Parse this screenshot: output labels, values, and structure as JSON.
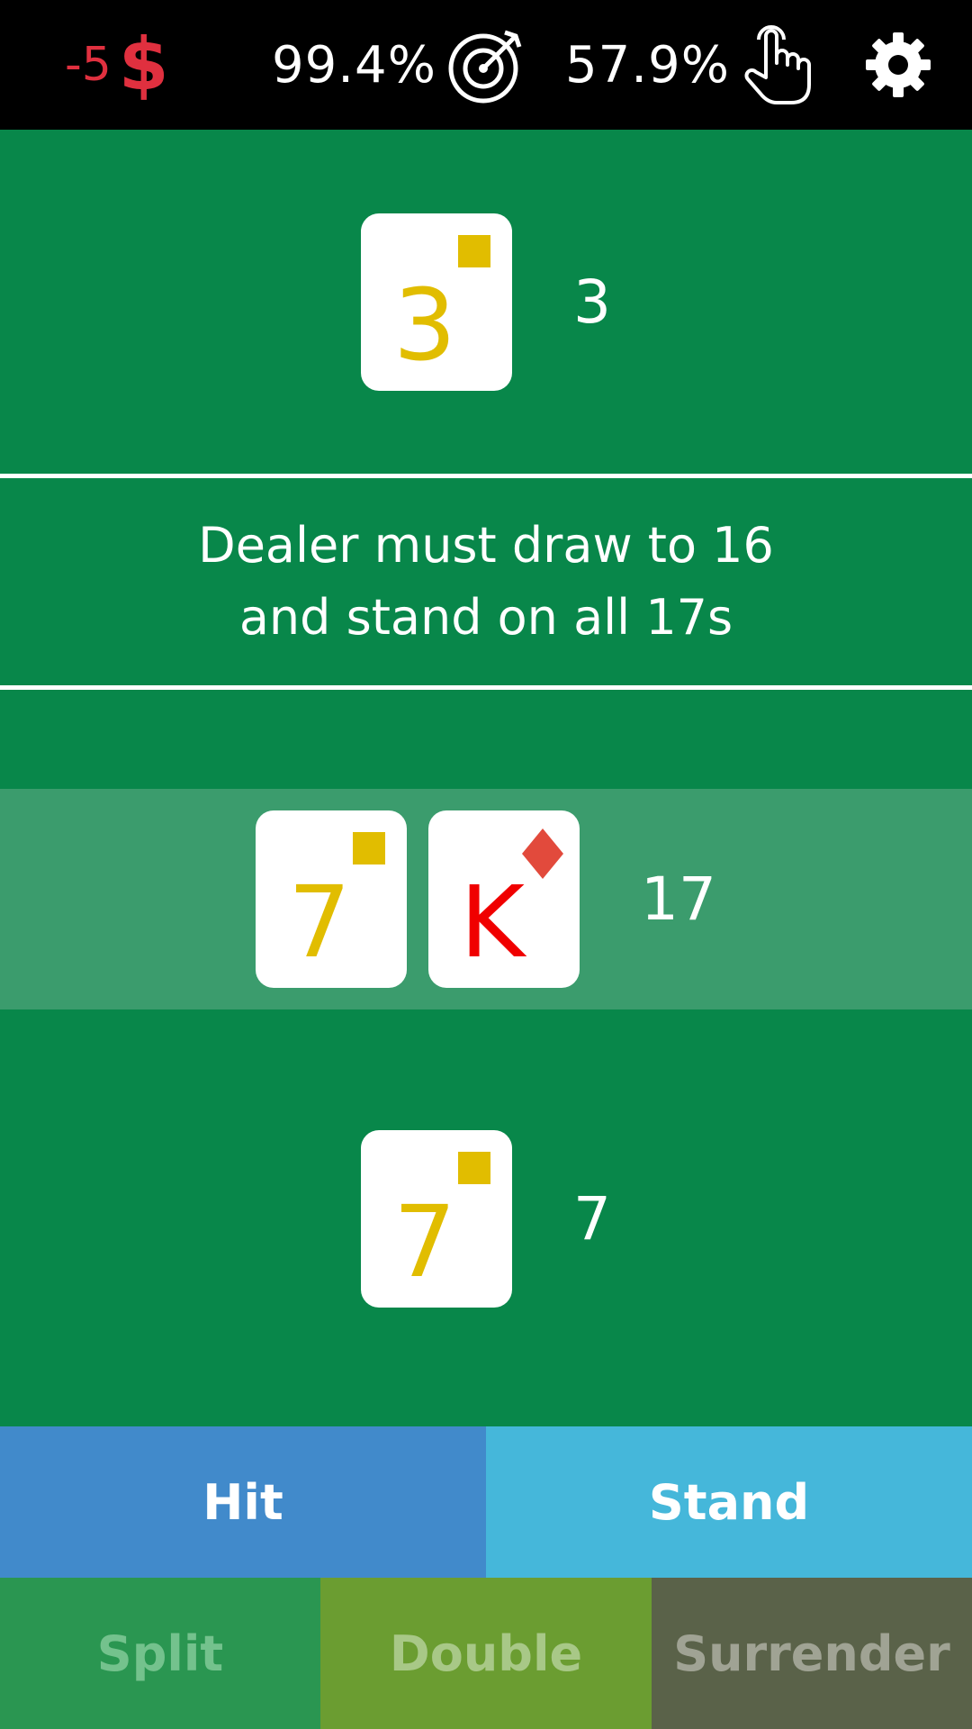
{
  "status_bar": {
    "balance": "-5",
    "currency_symbol": "$",
    "accuracy": "99.4%",
    "accuracy_icon": "target-icon",
    "win_rate": "57.9%",
    "win_rate_icon": "tap-hand-icon",
    "settings_icon": "gear-icon"
  },
  "dealer": {
    "cards": [
      {
        "rank": "3",
        "suit": "square",
        "color": "#e1bd00"
      }
    ],
    "total": "3"
  },
  "rule_text": {
    "line1": "Dealer must draw to 16",
    "line2": "and stand on all 17s"
  },
  "player_hands": [
    {
      "active": true,
      "cards": [
        {
          "rank": "7",
          "suit": "square",
          "color": "#e1bd00"
        },
        {
          "rank": "K",
          "suit": "diamond",
          "color": "#f00000"
        }
      ],
      "total": "17"
    },
    {
      "active": false,
      "cards": [
        {
          "rank": "7",
          "suit": "square",
          "color": "#e1bd00"
        }
      ],
      "total": "7"
    }
  ],
  "actions": {
    "hit": "Hit",
    "stand": "Stand",
    "split": "Split",
    "double": "Double",
    "surrender": "Surrender"
  },
  "colors": {
    "table_green": "#08874a",
    "active_hand_highlight": "#3b9c6d",
    "balance_negative": "#e0303f"
  }
}
